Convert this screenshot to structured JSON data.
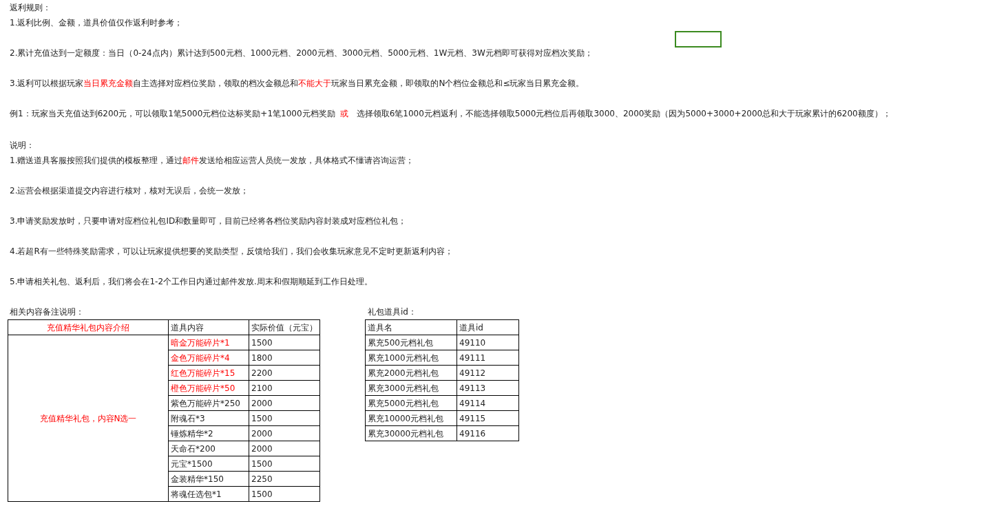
{
  "rules": {
    "title": "返利规则：",
    "items": [
      {
        "segments": [
          {
            "text": "1.返利比例、金额，道具价值仅作返利时参考；",
            "highlight": false
          }
        ]
      },
      {
        "segments": [
          {
            "text": "2.累计充值达到一定额度：当日（0-24点内）累计达到500元档、1000元档、2000元档、3000元档、5000元档、1W元档、3W元档即可获得对应档次奖励；",
            "highlight": false
          }
        ]
      },
      {
        "segments": [
          {
            "text": "3.返利可以根据玩家",
            "highlight": false
          },
          {
            "text": "当日累充金额",
            "highlight": true
          },
          {
            "text": "自主选择对应档位奖励，领取的档次金额总和",
            "highlight": false
          },
          {
            "text": "不能大于",
            "highlight": true
          },
          {
            "text": "玩家当日累充金额，即领取的N个档位金额总和≤玩家当日累充金额。",
            "highlight": false
          }
        ]
      },
      {
        "segments": [
          {
            "text": "例1：玩家当天充值达到6200元，可以领取1笔5000元档位达标奖励+1笔1000元档奖励  ",
            "highlight": false
          },
          {
            "text": "或",
            "highlight": true
          },
          {
            "text": "   选择领取6笔1000元档返利，不能选择领取5000元档位后再领取3000、2000奖励（因为5000+3000+2000总和大于玩家累计的6200额度）；",
            "highlight": false
          }
        ]
      }
    ]
  },
  "notes": {
    "title": "说明：",
    "items": [
      {
        "segments": [
          {
            "text": "1.赠送道具客服按照我们提供的模板整理，通过",
            "highlight": false
          },
          {
            "text": "邮件",
            "highlight": true
          },
          {
            "text": "发送给相应运营人员统一发放，具体格式不懂请咨询运营；",
            "highlight": false
          }
        ]
      },
      {
        "segments": [
          {
            "text": "2.运营会根据渠道提交内容进行核对，核对无误后，会统一发放；",
            "highlight": false
          }
        ]
      },
      {
        "segments": [
          {
            "text": "3.申请奖励发放时，只要申请对应档位礼包ID和数量即可，目前已经将各档位奖励内容封装成对应档位礼包；",
            "highlight": false
          }
        ]
      },
      {
        "segments": [
          {
            "text": "4.若超R有一些特殊奖励需求，可以让玩家提供想要的奖励类型，反馈给我们，我们会收集玩家意见不定时更新返利内容；",
            "highlight": false
          }
        ]
      },
      {
        "segments": [
          {
            "text": "5.申请相关礼包、返利后，我们将会在1-2个工作日内通过邮件发放.周末和假期顺延到工作日处理。",
            "highlight": false
          }
        ]
      }
    ]
  },
  "gift_table": {
    "caption": "相关内容备注说明：",
    "columns": [
      {
        "label": "充值精华礼包内容介绍",
        "highlight": true
      },
      {
        "label": "道具内容",
        "highlight": false
      },
      {
        "label": "实际价值（元宝）",
        "highlight": false
      }
    ],
    "group": {
      "label": "充值精华礼包，内容N选一",
      "highlight": true
    },
    "rows": [
      {
        "item": "暗金万能碎片*1",
        "value": "1500",
        "highlight": true
      },
      {
        "item": "金色万能碎片*4",
        "value": "1800",
        "highlight": true
      },
      {
        "item": "红色万能碎片*15",
        "value": "2200",
        "highlight": true
      },
      {
        "item": "橙色万能碎片*50",
        "value": "2100",
        "highlight": true
      },
      {
        "item": "紫色万能碎片*250",
        "value": "2000",
        "highlight": false
      },
      {
        "item": "附魂石*3",
        "value": "1500",
        "highlight": false
      },
      {
        "item": "锤炼精华*2",
        "value": "2000",
        "highlight": false
      },
      {
        "item": "天命石*200",
        "value": "2000",
        "highlight": false
      },
      {
        "item": "元宝*1500",
        "value": "1500",
        "highlight": false
      },
      {
        "item": "金装精华*150",
        "value": "2250",
        "highlight": false
      },
      {
        "item": "将魂任选包*1",
        "value": "1500",
        "highlight": false
      }
    ]
  },
  "id_table": {
    "caption": "礼包道具id：",
    "columns": [
      "道具名",
      "道具id"
    ],
    "rows": [
      {
        "name": "累充500元档礼包",
        "id": "49110"
      },
      {
        "name": "累充1000元档礼包",
        "id": "49111"
      },
      {
        "name": "累充2000元档礼包",
        "id": "49112"
      },
      {
        "name": "累充3000元档礼包",
        "id": "49113"
      },
      {
        "name": "累充5000元档礼包",
        "id": "49114"
      },
      {
        "name": "累充10000元档礼包",
        "id": "49115"
      },
      {
        "name": "累充30000元档礼包",
        "id": "49116"
      }
    ]
  }
}
